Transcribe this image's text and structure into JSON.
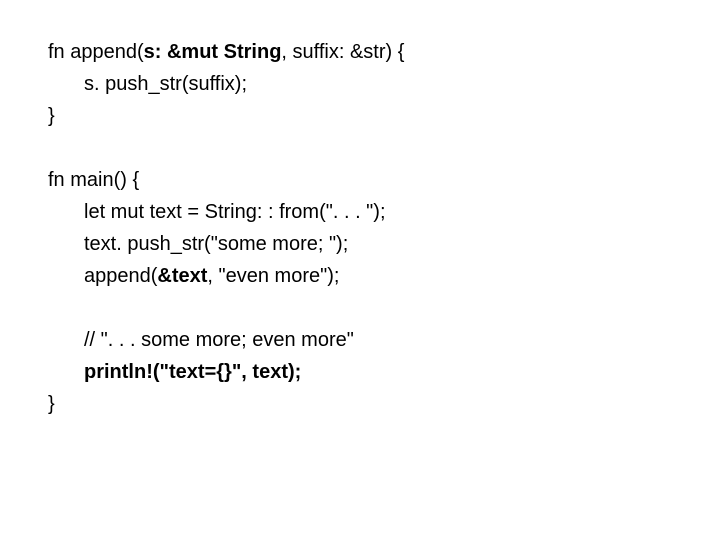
{
  "code": {
    "l1a": "fn append(",
    "l1b": "s: &mut String",
    "l1c": ", suffix: &str) {",
    "l2": "s. push_str(suffix);",
    "l3": "}",
    "l4": "fn main() {",
    "l5": "let mut text = String: : from(\". . . \");",
    "l6": "text. push_str(\"some more; \");",
    "l7a": "append(",
    "l7b": "&text",
    "l7c": ", \"even more\");",
    "l8": "// \". . . some more; even more\"",
    "l9": "println!(\"text={}\", text);",
    "l10": "}"
  }
}
